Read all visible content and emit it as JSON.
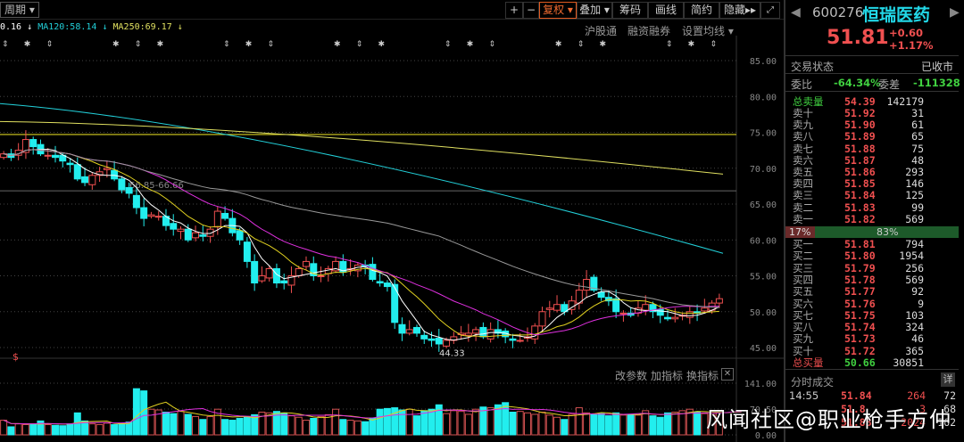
{
  "toolbar": {
    "period": "周期",
    "buttons": [
      "+",
      "−",
      "复权",
      "叠加",
      "筹码",
      "画线",
      "简约",
      "隐藏"
    ],
    "expand_icon": "fullscreen-icon"
  },
  "ma_legend": [
    {
      "text": "0.16",
      "color": "#ffffff"
    },
    {
      "text": "MA120:58.14",
      "color": "#22cfd8"
    },
    {
      "text": "MA250:69.17",
      "color": "#e0e060"
    }
  ],
  "sub_links": [
    "沪股通",
    "融资融券",
    "设置均线"
  ],
  "price_axis": [
    "85.00",
    "80.00",
    "75.00",
    "70.00",
    "65.00",
    "60.00",
    "55.00",
    "50.00",
    "45.00"
  ],
  "annotations": {
    "level_label": "66.85-66.66",
    "low_label": "44.33"
  },
  "indicator_links": [
    "改参数",
    "加指标",
    "换指标"
  ],
  "volume_axis": [
    "141.00",
    "70.50",
    "0.00"
  ],
  "kline_closes": [
    72,
    71.5,
    72.5,
    74,
    73,
    72,
    71.8,
    71.5,
    71,
    70.5,
    68.5,
    68,
    69,
    69.5,
    70,
    68.5,
    67,
    66.5,
    64.5,
    63,
    63.5,
    63.3,
    62,
    61.5,
    61.5,
    60,
    61,
    60.5,
    61.5,
    64,
    63,
    61,
    60,
    57,
    54,
    55,
    56,
    54,
    54,
    55,
    56,
    57,
    55,
    55,
    56,
    57,
    55.5,
    56,
    56.5,
    56.3,
    54.5,
    54,
    53.5,
    48.5,
    47,
    47.5,
    47,
    46.2,
    46,
    45.5,
    46,
    46.5,
    47,
    47,
    47.5,
    46.5,
    47.5,
    47,
    46.5,
    46,
    46,
    46.5,
    48,
    50,
    50.5,
    51,
    50,
    51.5,
    53,
    54.5,
    53,
    52,
    51.5,
    50,
    49.8,
    49.5,
    50.5,
    51,
    50,
    49.5,
    49,
    49.2,
    49.5,
    50,
    49.8,
    50.5,
    51.2,
    51.81
  ],
  "kline_volumes": [
    40,
    22,
    30,
    28,
    30,
    38,
    28,
    26,
    25,
    30,
    60,
    38,
    30,
    28,
    32,
    28,
    32,
    35,
    126,
    120,
    70,
    68,
    62,
    58,
    64,
    56,
    50,
    42,
    50,
    70,
    42,
    40,
    45,
    50,
    55,
    62,
    60,
    64,
    60,
    52,
    48,
    40,
    45,
    50,
    55,
    70,
    42,
    40,
    38,
    36,
    46,
    70,
    72,
    74,
    68,
    70,
    52,
    66,
    70,
    82,
    58,
    66,
    64,
    56,
    70,
    76,
    74,
    82,
    88,
    62,
    64,
    60,
    56,
    62,
    54,
    48,
    42,
    56,
    74,
    60,
    56,
    58,
    52,
    60,
    54,
    56,
    54,
    66,
    52,
    48,
    60,
    62,
    66,
    70,
    62,
    58,
    56,
    62,
    64,
    70,
    58
  ],
  "ma_series": {
    "ma120_start": 79,
    "ma120_end": 58.14,
    "ma250_start": 79,
    "ma250_end": 69.17,
    "hline": 74.7,
    "hline2": 66.85
  },
  "stock": {
    "code": "600276",
    "name": "恒瑞医药",
    "price": "51.81",
    "change": "+0.60",
    "change_pct": "+1.17%"
  },
  "status": {
    "label": "交易状态",
    "value": "已收市"
  },
  "ratio": {
    "label1": "委比",
    "value1": "-64.34%",
    "label2": "委差",
    "value2": "-111328"
  },
  "sell_total": {
    "label": "总卖量",
    "price": "54.39",
    "vol": "142179"
  },
  "sells": [
    [
      "卖十",
      "51.92",
      "31"
    ],
    [
      "卖九",
      "51.90",
      "61"
    ],
    [
      "卖八",
      "51.89",
      "65"
    ],
    [
      "卖七",
      "51.88",
      "75"
    ],
    [
      "卖六",
      "51.87",
      "48"
    ],
    [
      "卖五",
      "51.86",
      "293"
    ],
    [
      "卖四",
      "51.85",
      "146"
    ],
    [
      "卖三",
      "51.84",
      "125"
    ],
    [
      "卖二",
      "51.83",
      "99"
    ],
    [
      "卖一",
      "51.82",
      "569"
    ]
  ],
  "bar": {
    "left": "17%",
    "right": "83%"
  },
  "buys": [
    [
      "买一",
      "51.81",
      "794"
    ],
    [
      "买二",
      "51.80",
      "1954"
    ],
    [
      "买三",
      "51.79",
      "256"
    ],
    [
      "买四",
      "51.78",
      "569"
    ],
    [
      "买五",
      "51.77",
      "92"
    ],
    [
      "买六",
      "51.76",
      "9"
    ],
    [
      "买七",
      "51.75",
      "103"
    ],
    [
      "买八",
      "51.74",
      "324"
    ],
    [
      "买九",
      "51.73",
      "46"
    ],
    [
      "买十",
      "51.72",
      "365"
    ]
  ],
  "buy_total": {
    "label": "总买量",
    "price": "50.66",
    "vol": "30851"
  },
  "ticks": {
    "title": "分时成交",
    "detail": "详",
    "rows": [
      [
        "14:55",
        "51.84",
        "264",
        "72"
      ],
      [
        "",
        "51.8",
        "3",
        "68"
      ],
      [
        "",
        "51.83",
        "2024",
        "162"
      ]
    ]
  },
  "watermark": "风闻社区@职业枪手方仲"
}
